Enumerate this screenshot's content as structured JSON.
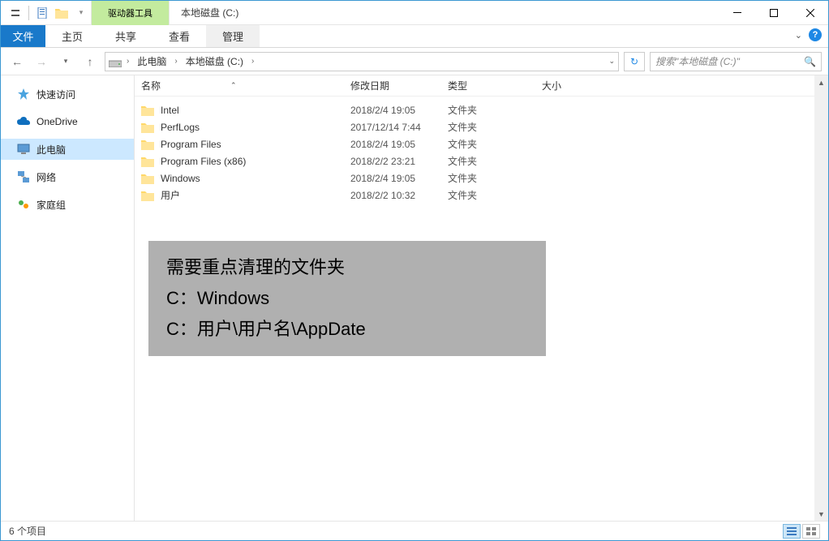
{
  "titlebar": {
    "context_tab": "驱动器工具",
    "window_title": "本地磁盘 (C:)"
  },
  "ribbon": {
    "file": "文件",
    "tabs": [
      "主页",
      "共享",
      "查看"
    ],
    "context": "管理"
  },
  "nav": {
    "crumbs": [
      "此电脑",
      "本地磁盘 (C:)"
    ],
    "search_placeholder": "搜索\"本地磁盘 (C:)\""
  },
  "sidebar": {
    "items": [
      {
        "label": "快速访问",
        "icon": "star",
        "color": "#4aa3df"
      },
      {
        "label": "OneDrive",
        "icon": "cloud",
        "color": "#0f6fbe"
      },
      {
        "label": "此电脑",
        "icon": "pc",
        "color": "#6a6a6a",
        "selected": true
      },
      {
        "label": "网络",
        "icon": "network",
        "color": "#3570c4"
      },
      {
        "label": "家庭组",
        "icon": "homegroup",
        "color": "#4caf50"
      }
    ]
  },
  "columns": {
    "name": "名称",
    "date": "修改日期",
    "type": "类型",
    "size": "大小"
  },
  "files": [
    {
      "name": "Intel",
      "date": "2018/2/4 19:05",
      "type": "文件夹"
    },
    {
      "name": "PerfLogs",
      "date": "2017/12/14 7:44",
      "type": "文件夹"
    },
    {
      "name": "Program Files",
      "date": "2018/2/4 19:05",
      "type": "文件夹"
    },
    {
      "name": "Program Files (x86)",
      "date": "2018/2/2 23:21",
      "type": "文件夹"
    },
    {
      "name": "Windows",
      "date": "2018/2/4 19:05",
      "type": "文件夹"
    },
    {
      "name": "用户",
      "date": "2018/2/2 10:32",
      "type": "文件夹"
    }
  ],
  "annotation": {
    "line1": "需要重点清理的文件夹",
    "line2": "C：Windows",
    "line3": "C：用户\\用户名\\AppDate"
  },
  "statusbar": {
    "count": "6 个项目"
  }
}
